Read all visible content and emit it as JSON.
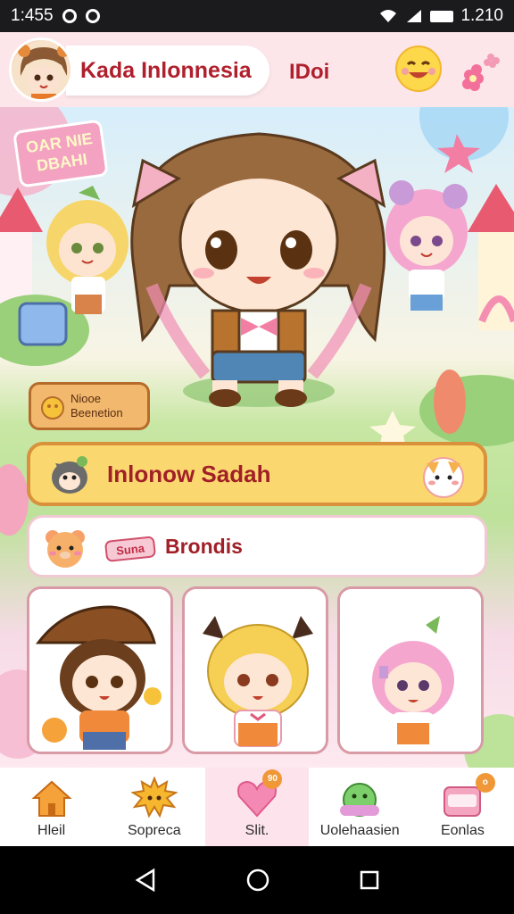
{
  "status_bar": {
    "time": "1:455",
    "battery": "1.210"
  },
  "header": {
    "title": "Kada Inlonnesia",
    "badge_text": "IDoi"
  },
  "scene": {
    "sign_text": "OAR NIE DBAHI"
  },
  "mini_button": {
    "line1": "Niooe",
    "line2": "Beenetion"
  },
  "primary_button": {
    "label": "Inlonow Sadah"
  },
  "secondary_button": {
    "sticker_text": "Suna",
    "label": "Brondis"
  },
  "cards": [
    {
      "name": "brown-hat-character"
    },
    {
      "name": "blonde-character"
    },
    {
      "name": "pink-hair-character"
    }
  ],
  "bottom_nav": {
    "items": [
      {
        "label": "Hleil",
        "icon": "home-icon"
      },
      {
        "label": "Sopreca",
        "icon": "sun-creature-icon"
      },
      {
        "label": "Slit.",
        "icon": "heart-icon",
        "badge": "90"
      },
      {
        "label": "Uolehaasien",
        "icon": "green-monster-icon"
      },
      {
        "label": "Eonlas",
        "icon": "gift-box-icon",
        "badge": "o"
      }
    ]
  },
  "colors": {
    "accent": "#a11f27",
    "primary": "#fbd86f",
    "background": "#fde9ef"
  }
}
